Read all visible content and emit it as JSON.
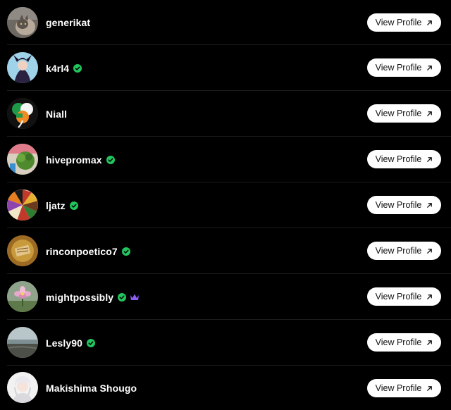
{
  "colors": {
    "background": "#000000",
    "verified": "#22c55e",
    "crown": "#8b5cf6",
    "button_bg": "#ffffff",
    "button_text": "#111111",
    "divider": "#1c1c1c"
  },
  "button_label": "View Profile",
  "button_icon": "arrow-up-right-icon",
  "users": [
    {
      "name": "generikat",
      "verified": false,
      "crown": false,
      "avatar": "cat-photo"
    },
    {
      "name": "k4rl4",
      "verified": true,
      "crown": false,
      "avatar": "illustrated-character"
    },
    {
      "name": "Niall",
      "verified": false,
      "crown": false,
      "avatar": "irish-shamrock"
    },
    {
      "name": "hivepromax",
      "verified": true,
      "crown": false,
      "avatar": "plant-photo"
    },
    {
      "name": "ljatz",
      "verified": true,
      "crown": false,
      "avatar": "colorful-fan"
    },
    {
      "name": "rinconpoetico7",
      "verified": true,
      "crown": false,
      "avatar": "golden-artwork"
    },
    {
      "name": "mightpossibly",
      "verified": true,
      "crown": true,
      "avatar": "pink-flower"
    },
    {
      "name": "Lesly90",
      "verified": true,
      "crown": false,
      "avatar": "beach-landscape"
    },
    {
      "name": "Makishima Shougo",
      "verified": false,
      "crown": false,
      "avatar": "anime-character"
    }
  ]
}
